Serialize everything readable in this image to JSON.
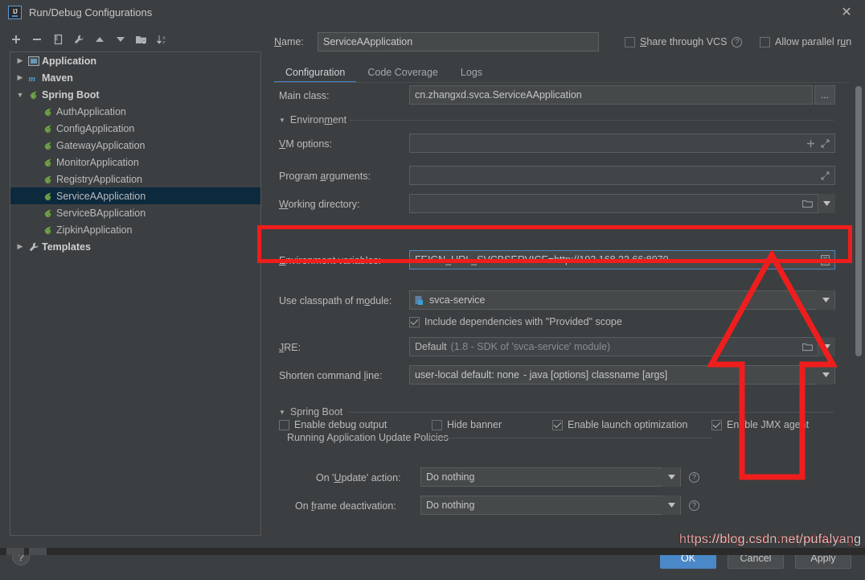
{
  "window": {
    "title": "Run/Debug Configurations",
    "logo_text": "IJ",
    "close_icon": "close-icon"
  },
  "toolbar": {
    "buttons": [
      {
        "name": "add-configuration-button",
        "icon": "plus-icon",
        "label": "+"
      },
      {
        "name": "remove-configuration-button",
        "icon": "minus-icon",
        "label": "−"
      },
      {
        "name": "copy-configuration-button",
        "icon": "copy-icon",
        "label": "Copy"
      },
      {
        "name": "edit-templates-button",
        "icon": "wrench-icon",
        "label": "Edit Templates"
      },
      {
        "name": "move-up-button",
        "icon": "arrow-up-icon",
        "label": "Move Up"
      },
      {
        "name": "move-down-button",
        "icon": "arrow-down-icon",
        "label": "Move Down"
      },
      {
        "name": "new-folder-button",
        "icon": "folder-add-icon",
        "label": "New Folder"
      },
      {
        "name": "sort-configurations-button",
        "icon": "sort-az-icon",
        "label": "Sort Configurations"
      }
    ]
  },
  "tree": {
    "items": [
      {
        "label": "Application",
        "icon": "application-icon",
        "level": 0,
        "expandable": true,
        "expanded": false,
        "bold": true,
        "selected": false
      },
      {
        "label": "Maven",
        "icon": "maven-icon",
        "level": 0,
        "expandable": true,
        "expanded": false,
        "bold": true,
        "selected": false
      },
      {
        "label": "Spring Boot",
        "icon": "spring-boot-icon",
        "level": 0,
        "expandable": true,
        "expanded": true,
        "bold": true,
        "selected": false
      },
      {
        "label": "AuthApplication",
        "icon": "spring-boot-icon",
        "level": 1,
        "expandable": false,
        "expanded": false,
        "bold": false,
        "selected": false
      },
      {
        "label": "ConfigApplication",
        "icon": "spring-boot-icon",
        "level": 1,
        "expandable": false,
        "expanded": false,
        "bold": false,
        "selected": false
      },
      {
        "label": "GatewayApplication",
        "icon": "spring-boot-icon",
        "level": 1,
        "expandable": false,
        "expanded": false,
        "bold": false,
        "selected": false
      },
      {
        "label": "MonitorApplication",
        "icon": "spring-boot-icon",
        "level": 1,
        "expandable": false,
        "expanded": false,
        "bold": false,
        "selected": false
      },
      {
        "label": "RegistryApplication",
        "icon": "spring-boot-icon",
        "level": 1,
        "expandable": false,
        "expanded": false,
        "bold": false,
        "selected": false
      },
      {
        "label": "ServiceAApplication",
        "icon": "spring-boot-icon",
        "level": 1,
        "expandable": false,
        "expanded": false,
        "bold": false,
        "selected": true
      },
      {
        "label": "ServiceBApplication",
        "icon": "spring-boot-icon",
        "level": 1,
        "expandable": false,
        "expanded": false,
        "bold": false,
        "selected": false
      },
      {
        "label": "ZipkinApplication",
        "icon": "spring-boot-icon",
        "level": 1,
        "expandable": false,
        "expanded": false,
        "bold": false,
        "selected": false
      },
      {
        "label": "Templates",
        "icon": "wrench-icon",
        "level": 0,
        "expandable": true,
        "expanded": false,
        "bold": true,
        "selected": false
      }
    ]
  },
  "help": {
    "icon": "help-icon",
    "label": "?"
  },
  "name_row": {
    "label": "Name:",
    "value": "ServiceAApplication",
    "share_vcs_label": "Share through VCS",
    "share_vcs_checked": false,
    "share_vcs_help_icon": "help-icon",
    "allow_parallel_label": "Allow parallel run",
    "allow_parallel_checked": false
  },
  "tabs": [
    {
      "label": "Configuration",
      "active": true
    },
    {
      "label": "Code Coverage",
      "active": false
    },
    {
      "label": "Logs",
      "active": false
    }
  ],
  "form": {
    "main_class": {
      "label": "Main class:",
      "value": "cn.zhangxd.svca.ServiceAApplication",
      "browse_label": "...",
      "browse_icon": "ellipsis-icon"
    },
    "environment_section": {
      "label": "Environment",
      "expanded": true
    },
    "vm_options": {
      "label": "VM options:",
      "value": "",
      "icons": [
        "plus-icon",
        "expand-icon"
      ]
    },
    "program_arguments": {
      "label": "Program arguments:",
      "value": "",
      "icons": [
        "expand-icon"
      ]
    },
    "working_directory": {
      "label": "Working directory:",
      "value": "",
      "icons": [
        "folder-icon",
        "chevron-down-icon"
      ]
    },
    "environment_variables": {
      "label": "Environment variables:",
      "value": "FEIGN_URL_SVCBSERVICE=http://192.168.23.66:8070",
      "icons": [
        "list-editor-icon"
      ],
      "focused": true
    },
    "use_classpath_of_module": {
      "label": "Use classpath of module:",
      "value": "svca-service",
      "module_icon": "module-icon",
      "icons": [
        "chevron-down-icon"
      ]
    },
    "include_provided": {
      "label": "Include dependencies with \"Provided\" scope",
      "checked": true
    },
    "jre": {
      "label": "JRE:",
      "value": "Default",
      "value_hint": "(1.8 - SDK of 'svca-service' module)",
      "icons": [
        "folder-icon",
        "chevron-down-icon"
      ]
    },
    "shorten_command_line": {
      "label": "Shorten command line:",
      "value": "user-local default: none",
      "value_hint": "- java [options] classname [args]",
      "icons": [
        "chevron-down-icon"
      ]
    },
    "spring_boot_section": {
      "label": "Spring Boot",
      "expanded": true
    },
    "spring_boot_checkboxes": [
      {
        "label": "Enable debug output",
        "checked": false
      },
      {
        "label": "Hide banner",
        "checked": false
      },
      {
        "label": "Enable launch optimization",
        "checked": true
      },
      {
        "label": "Enable JMX agent",
        "checked": true
      }
    ],
    "update_policies_section": {
      "label": "Running Application Update Policies"
    },
    "on_update_action": {
      "label": "On 'Update' action:",
      "value": "Do nothing",
      "help_icon": "help-icon"
    },
    "on_frame_deactivation": {
      "label": "On frame deactivation:",
      "value": "Do nothing",
      "help_icon": "help-icon"
    }
  },
  "buttons": {
    "ok": "OK",
    "cancel": "Cancel",
    "apply": "Apply"
  },
  "annotations": {
    "watermark": "https://blog.csdn.net/pufalyang",
    "rect_color": "#f01d1d",
    "arrow_color": "#f01d1d"
  },
  "colors": {
    "background": "#3c3f41",
    "field_background": "#45494a",
    "selection": "#0d293e",
    "accent": "#4a88c7",
    "annotation_red": "#f01d1d"
  }
}
